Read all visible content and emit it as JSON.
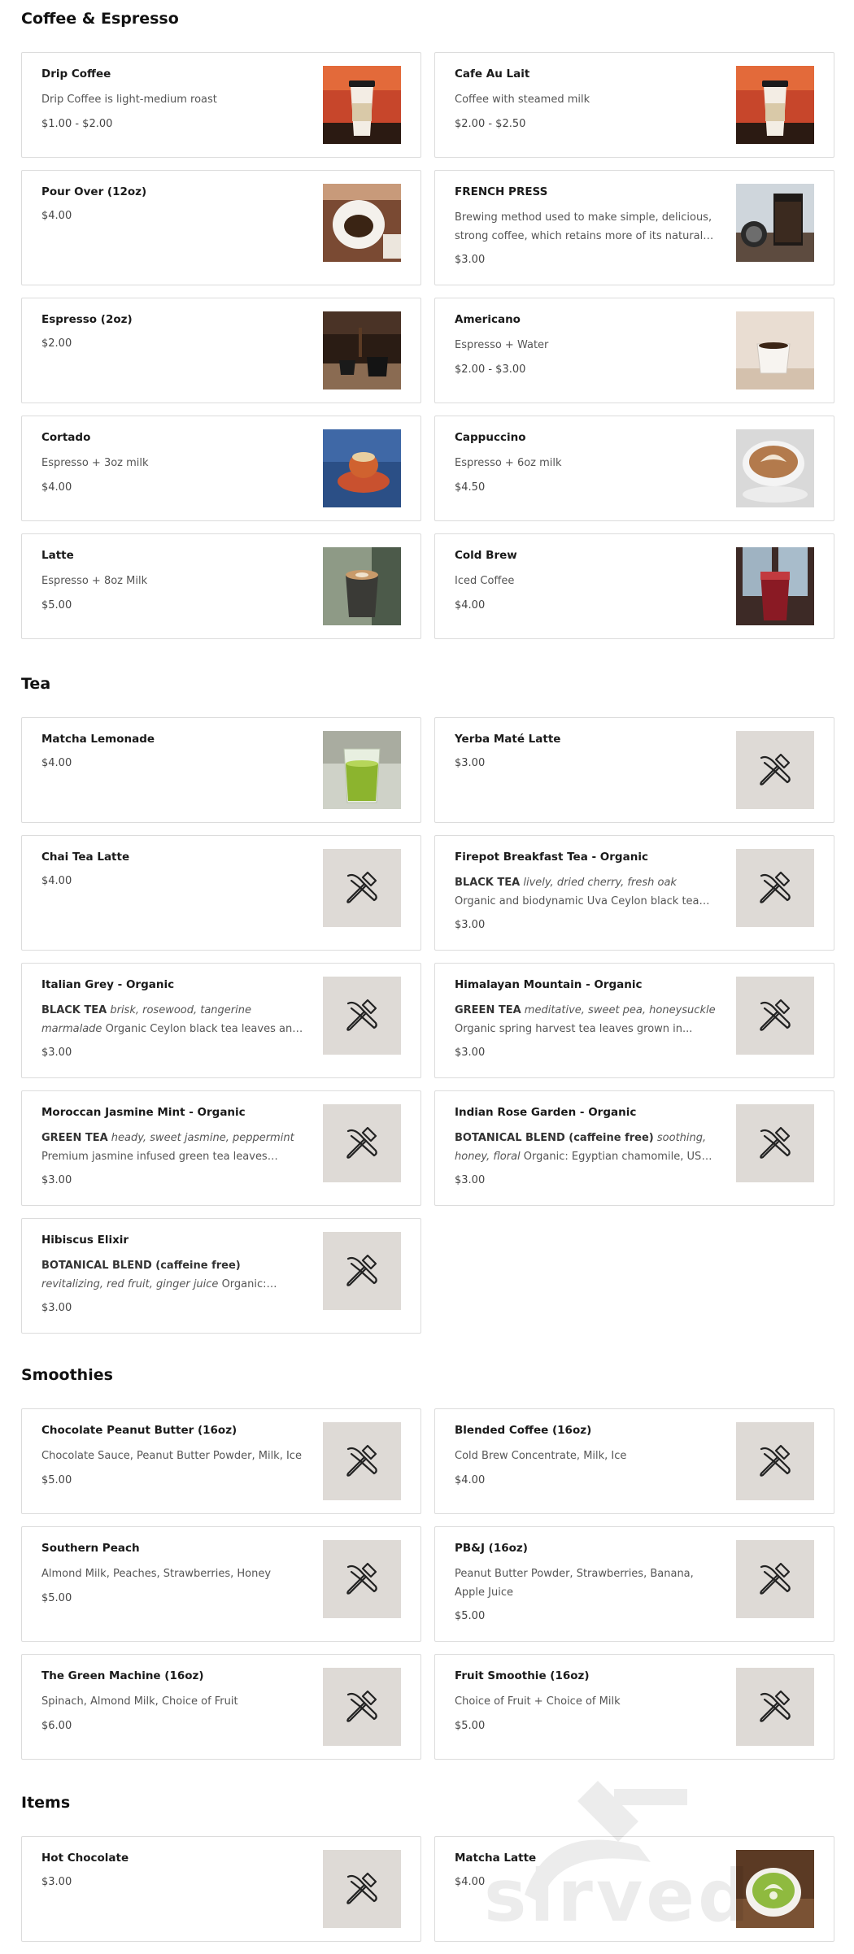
{
  "sections": [
    {
      "title": "Coffee & Espresso",
      "items": [
        {
          "name": "Drip Coffee",
          "desc": "Drip Coffee is light-medium roast",
          "price": "$1.00 - $2.00",
          "image": "coffee-cup-photo"
        },
        {
          "name": "Cafe Au Lait",
          "desc": "Coffee with steamed milk",
          "price": "$2.00 - $2.50",
          "image": "coffee-cup-photo"
        },
        {
          "name": "Pour Over (12oz)",
          "desc": "",
          "price": "$4.00",
          "image": "pour-over-photo"
        },
        {
          "name": "FRENCH PRESS",
          "desc": "Brewing method used to make simple, delicious, strong coffee, which retains more of its natural oils...",
          "price": "$3.00",
          "image": "french-press-photo"
        },
        {
          "name": "Espresso (2oz)",
          "desc": "",
          "price": "$2.00",
          "image": "espresso-photo"
        },
        {
          "name": "Americano",
          "desc": "Espresso + Water",
          "price": "$2.00 - $3.00",
          "image": "americano-photo"
        },
        {
          "name": "Cortado",
          "desc": "Espresso + 3oz milk",
          "price": "$4.00",
          "image": "cortado-photo"
        },
        {
          "name": "Cappuccino",
          "desc": "Espresso + 6oz milk",
          "price": "$4.50",
          "image": "cappuccino-photo"
        },
        {
          "name": "Latte",
          "desc": "Espresso + 8oz Milk",
          "price": "$5.00",
          "image": "latte-photo"
        },
        {
          "name": "Cold Brew",
          "desc": "Iced Coffee",
          "price": "$4.00",
          "image": "cold-brew-photo"
        }
      ]
    },
    {
      "title": "Tea",
      "items": [
        {
          "name": "Matcha Lemonade",
          "desc": "",
          "price": "$4.00",
          "image": "matcha-lemonade-photo"
        },
        {
          "name": "Yerba Maté Latte",
          "desc": "",
          "price": "$3.00",
          "image": "placeholder"
        },
        {
          "name": "Chai Tea Latte",
          "desc": "",
          "price": "$4.00",
          "image": "placeholder"
        },
        {
          "name": "Firepot Breakfast Tea - Organic",
          "desc_bold": "BLACK TEA",
          "desc_italic": "lively, dried cherry, fresh oak",
          "desc": "Organic and biodynamic Uva Ceylon black tea leaves and organi...",
          "price": "$3.00",
          "image": "placeholder"
        },
        {
          "name": "Italian Grey - Organic",
          "desc_bold": "BLACK TEA",
          "desc_italic": "brisk, rosewood, tangerine marmalade",
          "desc": "Organic Ceylon black tea leaves and organic and...",
          "price": "$3.00",
          "image": "placeholder"
        },
        {
          "name": "Himalayan Mountain - Organic",
          "desc_bold": "GREEN TEA",
          "desc_italic": "meditative, sweet pea, honeysuckle",
          "desc": "Organic spring harvest tea leaves grown in...",
          "price": "$3.00",
          "image": "placeholder"
        },
        {
          "name": "Moroccan Jasmine Mint - Organic",
          "desc_bold": "GREEN TEA",
          "desc_italic": "heady, sweet jasmine, peppermint",
          "desc": "Premium jasmine infused green tea leaves from...",
          "price": "$3.00",
          "image": "placeholder"
        },
        {
          "name": "Indian Rose Garden - Organic",
          "desc_bold": "BOTANICAL BLEND (caffeine free)",
          "desc_italic": "soothing, honey, floral",
          "desc": "Organic: Egyptian chamomile, USA spearmin...",
          "price": "$3.00",
          "image": "placeholder"
        },
        {
          "name": "Hibiscus Elixir",
          "desc_bold": "BOTANICAL BLEND (caffeine free)",
          "desc_italic": "revitalizing, red fruit, ginger juice",
          "desc": "Organic: hibiscus, rosehips, ginge...",
          "price": "$3.00",
          "image": "placeholder"
        }
      ]
    },
    {
      "title": "Smoothies",
      "items": [
        {
          "name": "Chocolate Peanut Butter (16oz)",
          "desc": "Chocolate Sauce, Peanut Butter Powder, Milk, Ice",
          "price": "$5.00",
          "image": "placeholder"
        },
        {
          "name": "Blended Coffee (16oz)",
          "desc": "Cold Brew Concentrate, Milk, Ice",
          "price": "$4.00",
          "image": "placeholder"
        },
        {
          "name": "Southern Peach",
          "desc": "Almond Milk, Peaches, Strawberries, Honey",
          "price": "$5.00",
          "image": "placeholder"
        },
        {
          "name": "PB&J (16oz)",
          "desc": "Peanut Butter Powder, Strawberries, Banana, Apple Juice",
          "price": "$5.00",
          "image": "placeholder"
        },
        {
          "name": "The Green Machine (16oz)",
          "desc": "Spinach, Almond Milk, Choice of Fruit",
          "price": "$6.00",
          "image": "placeholder"
        },
        {
          "name": "Fruit Smoothie (16oz)",
          "desc": "Choice of Fruit + Choice of Milk",
          "price": "$5.00",
          "image": "placeholder"
        }
      ]
    },
    {
      "title": "Items",
      "items": [
        {
          "name": "Hot Chocolate",
          "desc": "",
          "price": "$3.00",
          "image": "placeholder"
        },
        {
          "name": "Matcha Latte",
          "desc": "",
          "price": "$4.00",
          "image": "matcha-latte-photo"
        }
      ]
    }
  ],
  "watermark": {
    "text": "sirved"
  },
  "colors": {
    "placeholder_bg": "#dedad6",
    "border": "#dcdcdc",
    "text": "#222222"
  }
}
